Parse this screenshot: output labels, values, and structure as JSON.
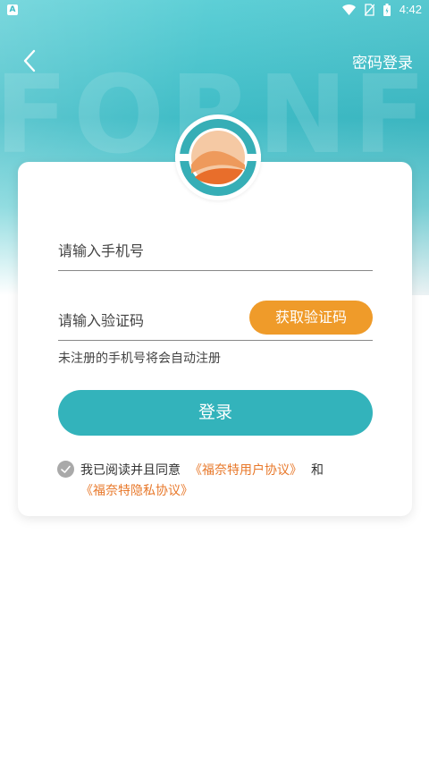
{
  "status_bar": {
    "time": "4:42",
    "left_badge": "A"
  },
  "header": {
    "password_login_label": "密码登录"
  },
  "watermark_text": "FORNFT",
  "form": {
    "phone_placeholder": "请输入手机号",
    "code_placeholder": "请输入验证码",
    "get_code_label": "获取验证码",
    "hint": "未注册的手机号将会自动注册",
    "login_label": "登录"
  },
  "agreement": {
    "prefix": "我已阅读并且同意",
    "user_agreement": "《福奈特用户协议》",
    "conjunction": "和",
    "privacy_agreement": "《福奈特隐私协议》"
  },
  "colors": {
    "accent": "#33b3bb",
    "orange": "#ef9b2a",
    "link": "#e8782a"
  }
}
